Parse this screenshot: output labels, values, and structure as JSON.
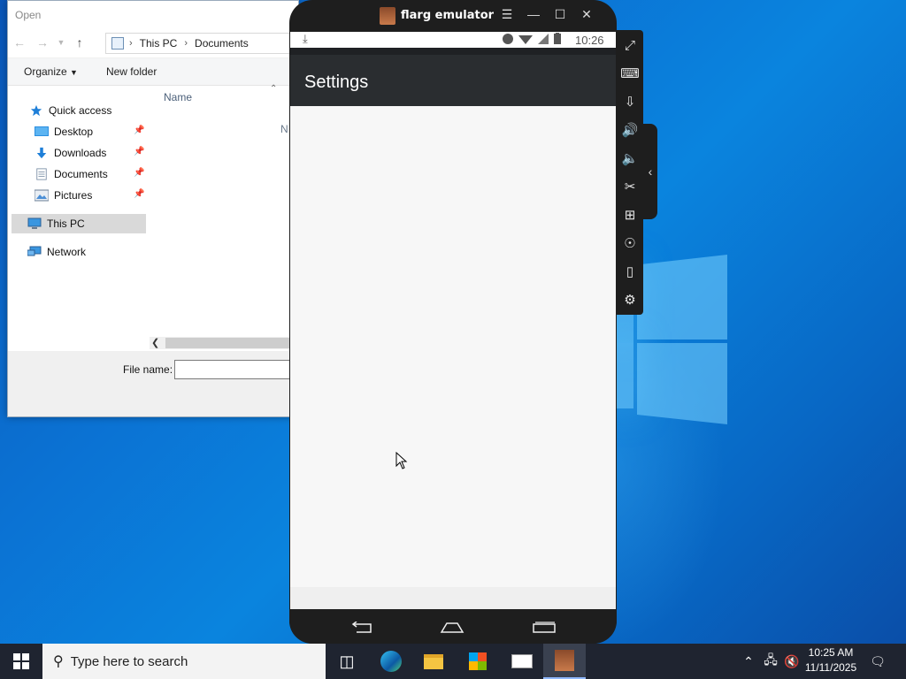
{
  "open_dialog": {
    "title": "Open",
    "address": {
      "segments": [
        "This PC",
        "Documents"
      ]
    },
    "toolbar": {
      "organize": "Organize",
      "new_folder": "New folder"
    },
    "nav_items": [
      {
        "label": "Quick access",
        "icon": "star-icon",
        "pinned": false
      },
      {
        "label": "Desktop",
        "icon": "desktop-folder-icon",
        "pinned": true
      },
      {
        "label": "Downloads",
        "icon": "downloads-icon",
        "pinned": true
      },
      {
        "label": "Documents",
        "icon": "documents-icon",
        "pinned": true
      },
      {
        "label": "Pictures",
        "icon": "pictures-icon",
        "pinned": true
      },
      {
        "label": "This PC",
        "icon": "this-pc-icon",
        "pinned": false,
        "selected": true
      },
      {
        "label": "Network",
        "icon": "network-icon",
        "pinned": false
      }
    ],
    "column_header": "Name",
    "clipped_text": "N",
    "file_name_label": "File name:",
    "file_name_value": ""
  },
  "emulator": {
    "app_name": "flarg emulator",
    "status_time": "10:26",
    "screen_title": "Settings"
  },
  "taskbar": {
    "search_placeholder": "Type here to search",
    "time": "10:25 AM",
    "date": "11/11/2025"
  },
  "colors": {
    "desktop_blue": "#0b73d4",
    "taskbar": "#1f2430",
    "emulator_frame": "#1e1e1e",
    "app_bar": "#2a2d30",
    "selection": "#d9d9d9"
  }
}
